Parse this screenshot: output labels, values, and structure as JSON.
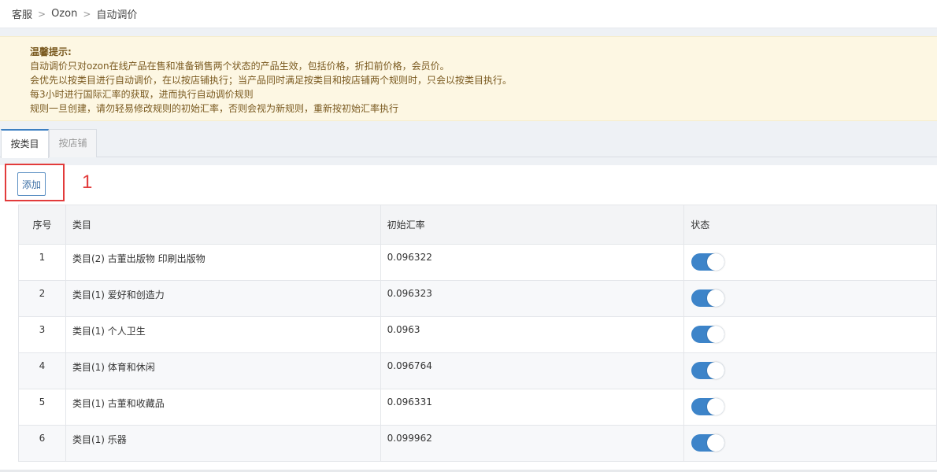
{
  "breadcrumb": {
    "items": [
      "客服",
      "Ozon",
      "自动调价"
    ]
  },
  "notice": {
    "title": "温馨提示:",
    "lines": [
      "自动调价只对ozon在线产品在售和准备销售两个状态的产品生效，包括价格，折扣前价格，会员价。",
      "会优先以按类目进行自动调价，在以按店铺执行；当产品同时满足按类目和按店铺两个规则时，只会以按类目执行。",
      "每3小时进行国际汇率的获取，进而执行自动调价规则",
      "规则一旦创建，请勿轻易修改规则的初始汇率，否则会视为新规则，重新按初始汇率执行"
    ]
  },
  "tabs": [
    {
      "label": "按类目",
      "active": true
    },
    {
      "label": "按店铺",
      "active": false
    }
  ],
  "toolbar": {
    "add_label": "添加",
    "annotation": "1"
  },
  "table": {
    "headers": [
      "序号",
      "类目",
      "初始汇率",
      "状态"
    ],
    "rows": [
      {
        "index": "1",
        "category": "类目(2) 古董出版物 印刷出版物",
        "rate": "0.096322",
        "enabled": true
      },
      {
        "index": "2",
        "category": "类目(1) 爱好和创造力",
        "rate": "0.096323",
        "enabled": true
      },
      {
        "index": "3",
        "category": "类目(1) 个人卫生",
        "rate": "0.0963",
        "enabled": true
      },
      {
        "index": "4",
        "category": "类目(1) 体育和休闲",
        "rate": "0.096764",
        "enabled": true
      },
      {
        "index": "5",
        "category": "类目(1) 古董和收藏品",
        "rate": "0.096331",
        "enabled": true
      },
      {
        "index": "6",
        "category": "类目(1) 乐器",
        "rate": "0.099962",
        "enabled": true
      }
    ]
  },
  "colors": {
    "accent": "#3d84c9",
    "notice_bg": "#fdf7e3",
    "highlight": "#e23b3b"
  }
}
